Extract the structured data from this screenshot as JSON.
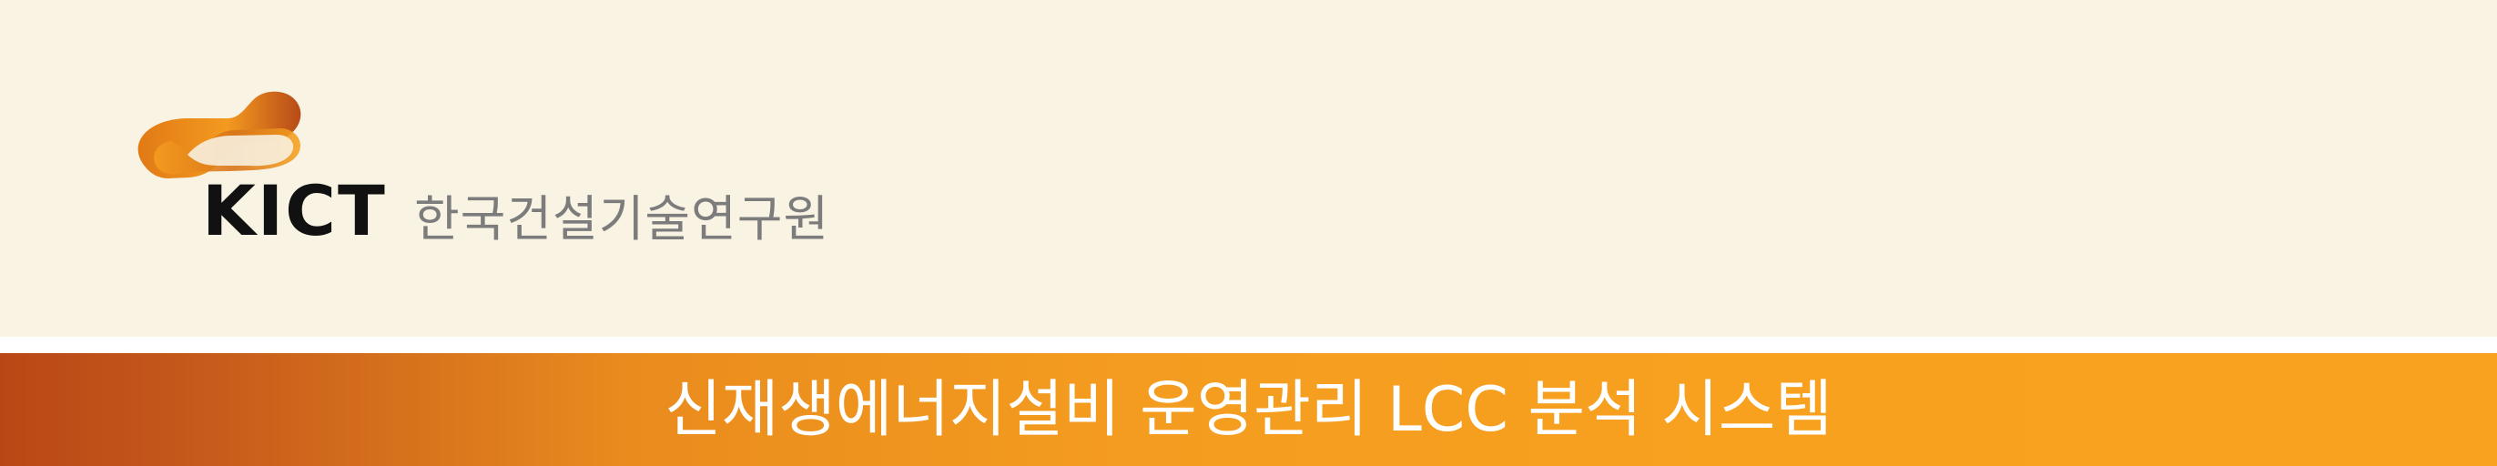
{
  "header": {
    "logo": {
      "mark_icon": "kict-infinity-logo-icon",
      "wordmark": "KICT",
      "organization_name": "한국건설기술연구원"
    }
  },
  "banner": {
    "title": "신재생에너지설비 운영관리 LCC 분석 시스템"
  },
  "colors": {
    "background": "#f8f3e3",
    "banner_start": "#b94716",
    "banner_end": "#f9a21f",
    "text_dark": "#111111",
    "text_gray": "#7c7c7c",
    "logo_orange": "#f49c1f"
  }
}
